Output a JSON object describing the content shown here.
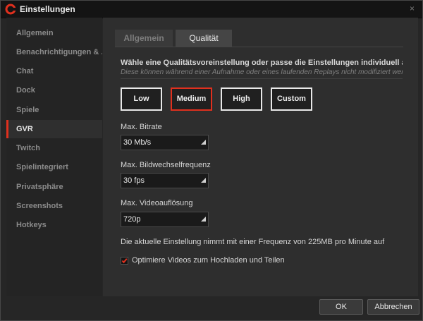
{
  "window": {
    "title": "Einstellungen",
    "close_glyph": "×"
  },
  "sidebar": {
    "items": [
      {
        "label": "Allgemein",
        "active": false
      },
      {
        "label": "Benachrichtigungen & ...",
        "active": false
      },
      {
        "label": "Chat",
        "active": false
      },
      {
        "label": "Dock",
        "active": false
      },
      {
        "label": "Spiele",
        "active": false
      },
      {
        "label": "GVR",
        "active": true
      },
      {
        "label": "Twitch",
        "active": false
      },
      {
        "label": "Spielintegriert",
        "active": false
      },
      {
        "label": "Privatsphäre",
        "active": false
      },
      {
        "label": "Screenshots",
        "active": false
      },
      {
        "label": "Hotkeys",
        "active": false
      }
    ]
  },
  "tabs": [
    {
      "label": "Allgemein",
      "active": false
    },
    {
      "label": "Qualität",
      "active": true
    }
  ],
  "quality": {
    "intro": "Wähle eine Qualitätsvoreinstellung oder passe die Einstellungen individuell an.",
    "intro_note": "Diese können während einer Aufnahme oder eines laufenden Replays nicht modifiziert werden.",
    "presets": [
      {
        "label": "Low",
        "selected": false
      },
      {
        "label": "Medium",
        "selected": true
      },
      {
        "label": "High",
        "selected": false
      },
      {
        "label": "Custom",
        "selected": false
      }
    ],
    "bitrate": {
      "label": "Max. Bitrate",
      "value": "30 Mb/s"
    },
    "framerate": {
      "label": "Max. Bildwechselfrequenz",
      "value": "30 fps"
    },
    "resolution": {
      "label": "Max. Videoauflösung",
      "value": "720p"
    },
    "info": "Die aktuelle Einstellung nimmt mit einer Frequenz von 225MB pro Minute auf",
    "optimize": {
      "label": "Optimiere Videos zum Hochladen und Teilen",
      "checked": true
    }
  },
  "footer": {
    "ok_label": "OK",
    "cancel_label": "Abbrechen"
  },
  "colors": {
    "accent": "#e0301e",
    "background": "#262626",
    "panel": "#2e2e2e"
  },
  "icons": {
    "logo": "app-logo-icon",
    "close": "close-icon",
    "dropdown": "dropdown-arrow-icon",
    "check": "checkmark-icon"
  }
}
